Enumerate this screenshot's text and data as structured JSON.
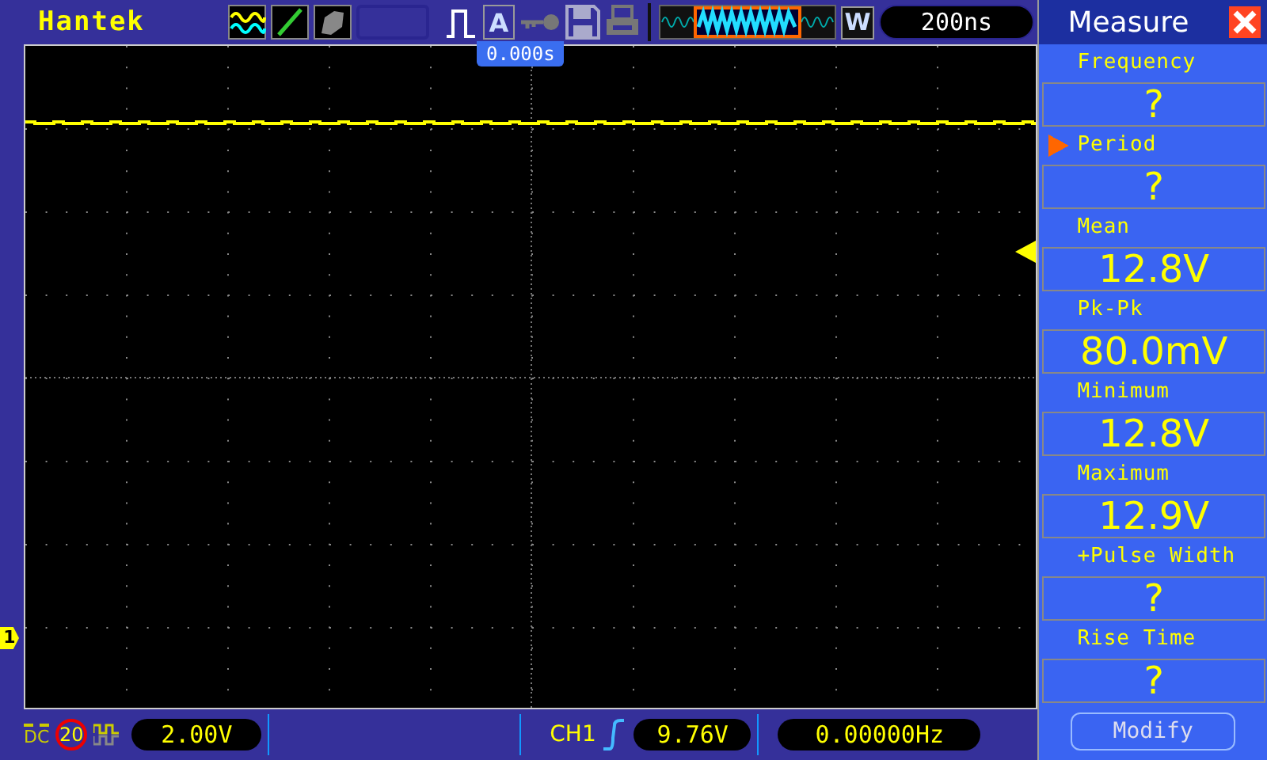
{
  "header": {
    "logo": "Hantek",
    "auto_button": "A",
    "window_button": "W",
    "timebase": "200ns",
    "trigger_position": "0.000s"
  },
  "channel_marker": "1",
  "panel": {
    "title": "Measure",
    "button": "Modify",
    "measurements": [
      {
        "label": "Frequency",
        "value": "?",
        "selected": false
      },
      {
        "label": "Period",
        "value": "?",
        "selected": true
      },
      {
        "label": "Mean",
        "value": "12.8V",
        "selected": false
      },
      {
        "label": "Pk-Pk",
        "value": "80.0mV",
        "selected": false
      },
      {
        "label": "Minimum",
        "value": "12.8V",
        "selected": false
      },
      {
        "label": "Maximum",
        "value": "12.9V",
        "selected": false
      },
      {
        "label": "+Pulse Width",
        "value": "?",
        "selected": false
      },
      {
        "label": "Rise Time",
        "value": "?",
        "selected": false
      }
    ]
  },
  "status_bar": {
    "coupling": "DC",
    "bandwidth_limit": "20",
    "volts_per_div": "2.00V",
    "trigger_source": "CH1",
    "trigger_level": "9.76V",
    "frequency": "0.00000Hz"
  }
}
